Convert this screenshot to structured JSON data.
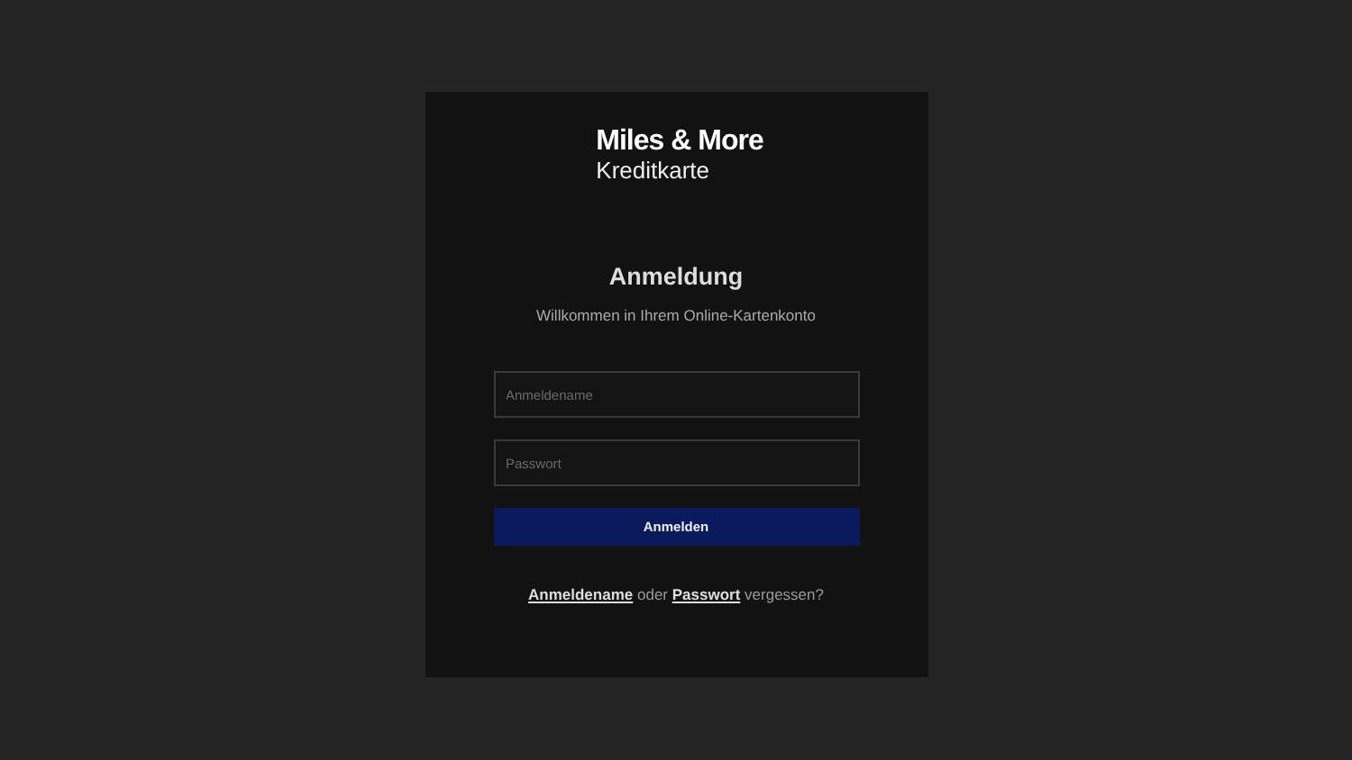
{
  "logo": {
    "title": "Miles & More",
    "subtitle": "Kreditkarte"
  },
  "heading": "Anmeldung",
  "subheading": "Willkommen in Ihrem Online-Kartenkonto",
  "fields": [
    {
      "placeholder": "Anmeldename"
    },
    {
      "placeholder": "Passwort"
    }
  ],
  "submit_button": "Anmelden",
  "forgot": [
    {
      "kind": "link",
      "text": "Anmeldename"
    },
    {
      "kind": "text",
      "text": " oder "
    },
    {
      "kind": "link",
      "text": "Passwort"
    },
    {
      "kind": "text",
      "text": " vergessen?"
    }
  ]
}
